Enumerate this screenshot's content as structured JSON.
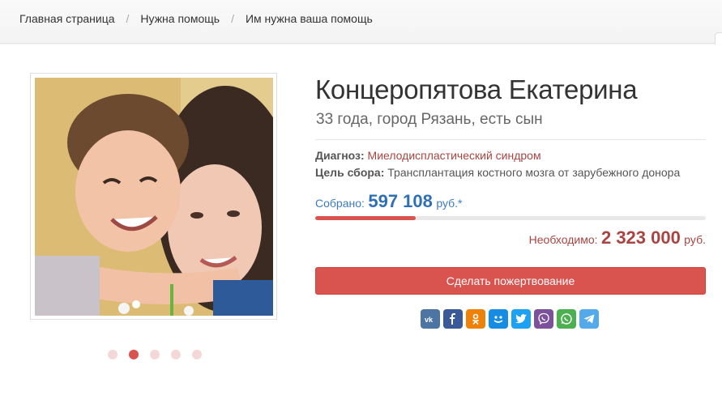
{
  "breadcrumb": {
    "items": [
      "Главная страница",
      "Нужна помощь",
      "Им нужна ваша помощь"
    ],
    "separator": "/"
  },
  "profile": {
    "name": "Концеропятова Екатерина",
    "subtitle": "33 года, город Рязань, есть сын"
  },
  "details": {
    "diagnosis_label": "Диагноз:",
    "diagnosis_value": "Миелодиспластический синдром",
    "goal_label": "Цель сбора:",
    "goal_value": "Трансплантация костного мозга от зарубежного донора"
  },
  "fundraising": {
    "collected_label": "Собрано:",
    "collected_amount": "597 108",
    "collected_currency": "руб.*",
    "needed_label": "Необходимо:",
    "needed_amount": "2 323 000",
    "needed_currency": "руб.",
    "progress_fraction": 0.257
  },
  "donate_button": "Сделать пожертвование",
  "gallery": {
    "dots": 5,
    "active_index": 1
  },
  "share": [
    {
      "name": "vk-icon",
      "color": "#4c75a3"
    },
    {
      "name": "facebook-icon",
      "color": "#3b5998"
    },
    {
      "name": "odnoklassniki-icon",
      "color": "#ee8208"
    },
    {
      "name": "moimir-icon",
      "color": "#168de2"
    },
    {
      "name": "twitter-icon",
      "color": "#1da1f2"
    },
    {
      "name": "viber-icon",
      "color": "#7b519d"
    },
    {
      "name": "whatsapp-icon",
      "color": "#4caf50"
    },
    {
      "name": "telegram-icon",
      "color": "#54a9eb"
    }
  ],
  "colors": {
    "accent": "#d9534f",
    "link_blue": "#2f6fb3",
    "diagnosis_red": "#a94442"
  }
}
